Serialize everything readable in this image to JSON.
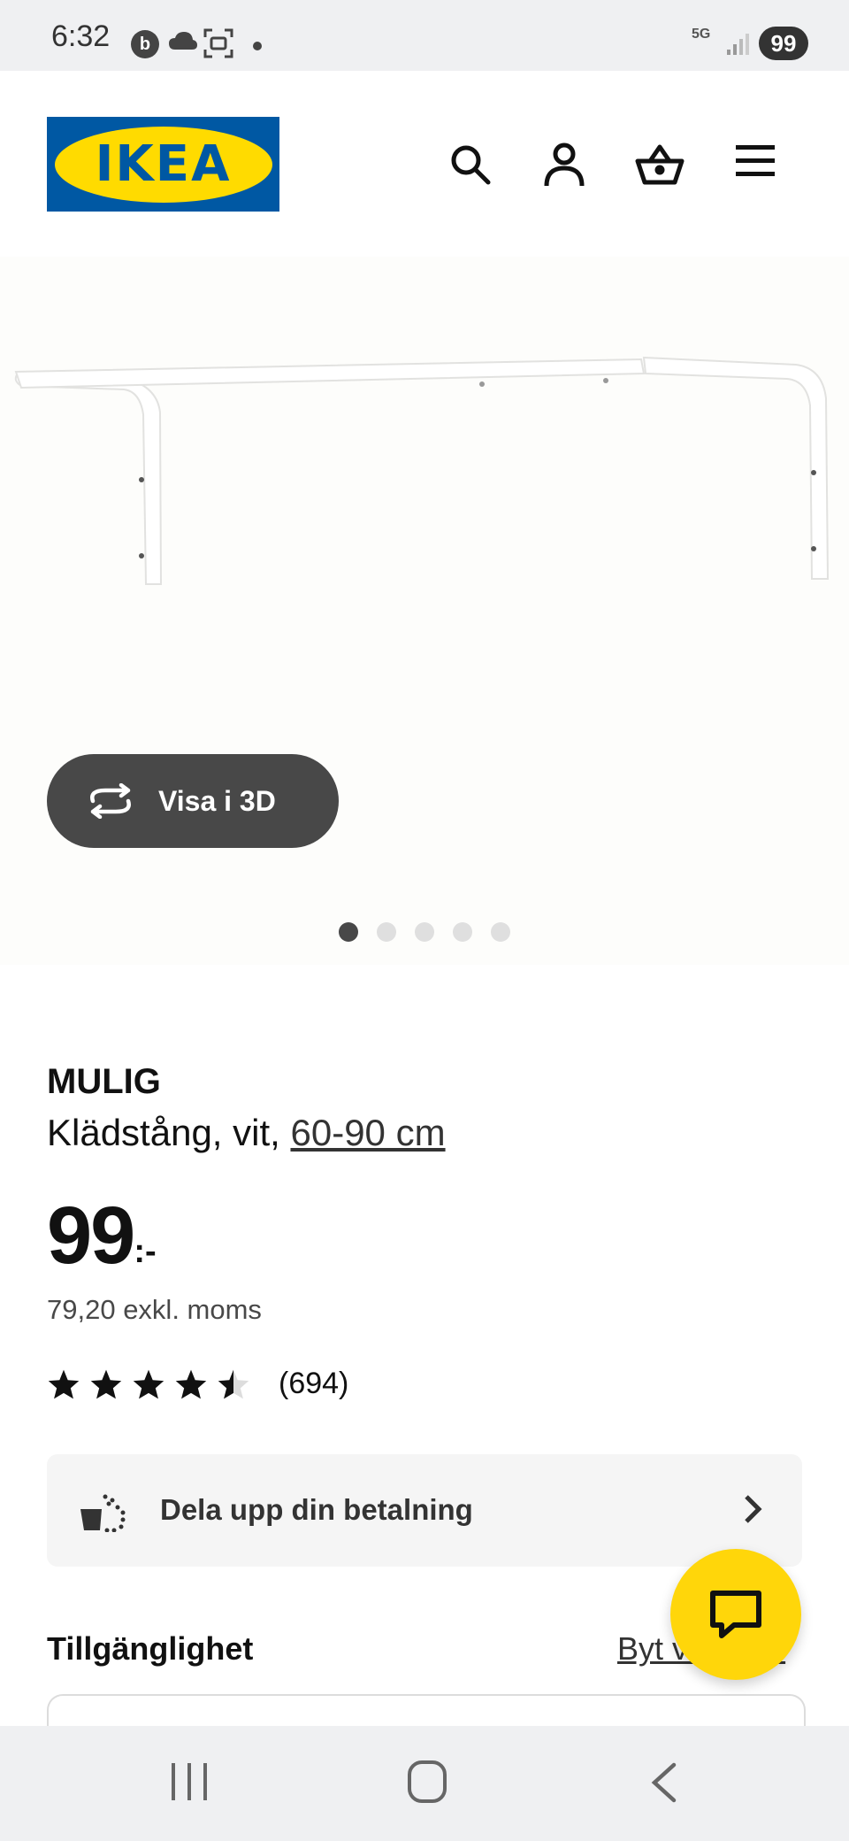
{
  "status_bar": {
    "time": "6:32",
    "badge_letter": "b",
    "network": "5G",
    "battery": "99"
  },
  "header": {
    "logo_text": "IKEA",
    "brand_colors": {
      "blue": "#0058a3",
      "yellow": "#ffdb00"
    },
    "icons": [
      "search-icon",
      "account-icon",
      "cart-icon",
      "menu-icon"
    ]
  },
  "gallery": {
    "view_3d_label": "Visa i 3D",
    "dot_count": 5,
    "active_dot": 1
  },
  "product": {
    "name": "MULIG",
    "description_prefix": "Klädstång, vit,",
    "size": "60-90 cm",
    "price_main": "99",
    "price_suffix": ":-",
    "price_excl_vat": "79,20 exkl. moms",
    "rating_value": 4.5,
    "rating_max": 5,
    "review_count": "(694)"
  },
  "installment": {
    "label": "Dela upp din betalning"
  },
  "availability": {
    "title": "Tillgänglighet",
    "change_link": "Byt varuhus"
  },
  "chat": {
    "icon": "chat-icon",
    "color": "#ffd60a"
  },
  "nav": {
    "icons": [
      "recent-apps-icon",
      "home-icon",
      "back-icon"
    ]
  }
}
